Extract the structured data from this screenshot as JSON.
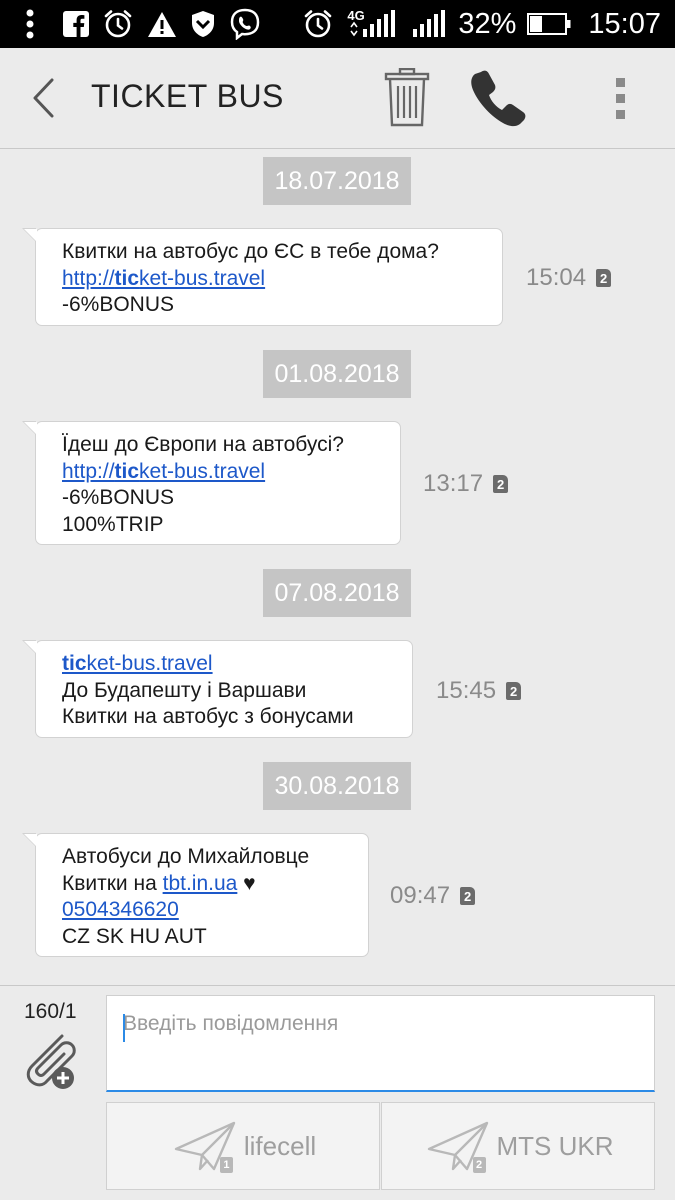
{
  "status_bar": {
    "signal_type": "4G",
    "battery": "32%",
    "time": "15:07",
    "icons": [
      "more-vert-icon",
      "facebook-icon",
      "alarm-icon",
      "warning-icon",
      "shield-icon",
      "viber-icon",
      "alarm-icon",
      "signal-icon",
      "battery-icon"
    ]
  },
  "header": {
    "title": "TICKET BUS",
    "icons": [
      "back-arrow-icon",
      "trash-icon",
      "phone-icon",
      "more-vert-icon"
    ]
  },
  "conversation": {
    "groups": [
      {
        "date": "18.07.2018",
        "message": {
          "line1": "Квитки на автобус до ЄС в тебе дома?",
          "link_prefix": "http://",
          "link_bold": "tic",
          "link_rest": "ket-bus.travel",
          "line3": "-6%BONUS",
          "time": "15:04",
          "sim": "2"
        }
      },
      {
        "date": "01.08.2018",
        "message": {
          "line1": "Їдеш до Європи на автобусі?",
          "link_prefix": "http://",
          "link_bold": "tic",
          "link_rest": "ket-bus.travel",
          "line3": "-6%BONUS",
          "line4": "100%TRIP",
          "time": "13:17",
          "sim": "2"
        }
      },
      {
        "date": "07.08.2018",
        "message": {
          "link_bold": "tic",
          "link_rest": "ket-bus.travel",
          "line2": "До Будапешту і Варшави",
          "line3": "Квитки на автобус з бонусами",
          "time": "15:45",
          "sim": "2"
        }
      },
      {
        "date": "30.08.2018",
        "message": {
          "line1": "Автобуси до Михайловце",
          "line2_prefix": "Квитки на ",
          "line2_link": "tbt.in.ua",
          "line2_suffix": " ♥",
          "phone": "0504346620",
          "line4": "CZ SK HU AUT",
          "time": "09:47",
          "sim": "2"
        }
      }
    ]
  },
  "composer": {
    "char_count": "160/1",
    "placeholder": "Введіть повідомлення",
    "send_sim1": {
      "label": "lifecell",
      "sim": "1"
    },
    "send_sim2": {
      "label": "MTS UKR",
      "sim": "2"
    }
  },
  "colors": {
    "background": "#ebebeb",
    "link": "#1d58c9",
    "date_chip": "#c5c5c5",
    "input_accent": "#2b8ae6"
  }
}
